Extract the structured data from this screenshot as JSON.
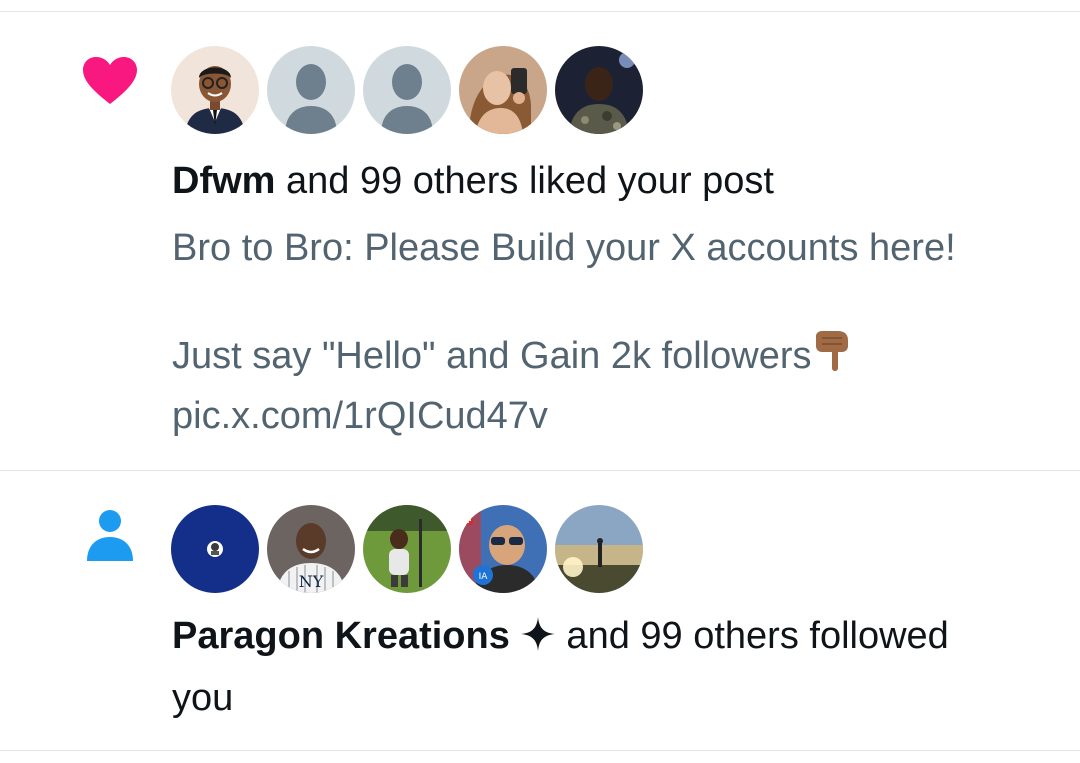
{
  "notifications": [
    {
      "type": "like",
      "type_icon": "heart-icon",
      "accent": "#f91880",
      "avatars": [
        "cartoon-man-avatar",
        "default-avatar",
        "default-avatar",
        "woman-selfie-avatar",
        "man-night-avatar"
      ],
      "actor": "Dfwm",
      "action": " and 99 others liked your post",
      "post_lines": [
        "Bro to Bro: Please Build your X accounts here!",
        "",
        "Just say \"Hello\" and Gain 2k followers",
        "pic.x.com/1rQICud47v"
      ],
      "emoji": "pointing-down-hand-icon"
    },
    {
      "type": "follow",
      "type_icon": "person-icon",
      "accent": "#1d9bf0",
      "avatars": [
        "navy-logo-avatar",
        "yankees-player-avatar",
        "stadium-man-avatar",
        "sunglasses-man-avatar",
        "sunset-silhouette-avatar"
      ],
      "actor": "Paragon Kreations",
      "actor_badge": "sparkle-icon",
      "action_line1": " and 99 others followed",
      "action_line2": "you"
    }
  ]
}
